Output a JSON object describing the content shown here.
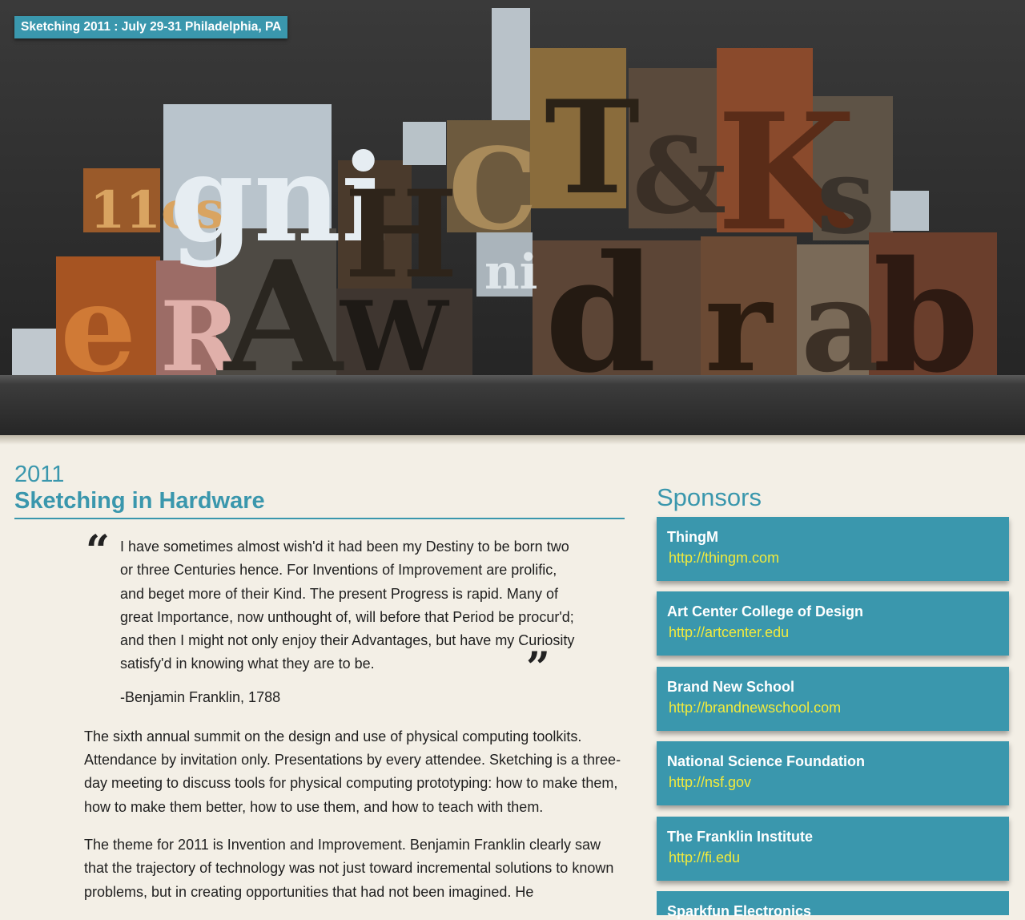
{
  "hero": {
    "badge": "Sketching 2011 : July 29-31 Philadelphia, PA",
    "image": "wood-type-letterpress-blocks"
  },
  "main": {
    "year": "2011",
    "title": "Sketching in Hardware",
    "quote": "I have sometimes almost wish'd it had been my Destiny to be born two or three Centuries hence. For Inventions of Improvement are prolific, and beget more of their Kind. The present Progress is rapid. Many of great Importance, now unthought of, will before that Period be procur'd; and then I might not only enjoy their Advantages, but have my Curiosity satisfy'd in knowing what they are to be.",
    "attribution": "-Benjamin Franklin, 1788",
    "paragraph1": "The sixth annual summit on the design and use of physical computing toolkits. Attendance by invitation only. Presentations by every attendee. Sketching is a three-day meeting to discuss tools for physical computing prototyping: how to make them, how to make them better, how to use them, and how to teach with them.",
    "paragraph2": "The theme for 2011 is Invention and Improvement. Benjamin Franklin clearly saw that the trajectory of technology was not just toward incremental solutions to known problems, but in creating opportunities that had not been imagined. He"
  },
  "sponsors": {
    "heading": "Sponsors",
    "items": [
      {
        "name": "ThingM",
        "url": "http://thingm.com"
      },
      {
        "name": "Art Center College of Design",
        "url": "http://artcenter.edu"
      },
      {
        "name": "Brand New School",
        "url": "http://brandnewschool.com"
      },
      {
        "name": "National Science Foundation",
        "url": "http://nsf.gov"
      },
      {
        "name": "The Franklin Institute",
        "url": "http://fi.edu"
      },
      {
        "name": "Sparkfun Electronics",
        "url": ""
      }
    ]
  },
  "colors": {
    "accent": "#3a97ad",
    "link": "#f2ea3c",
    "background": "#f3efe6"
  }
}
